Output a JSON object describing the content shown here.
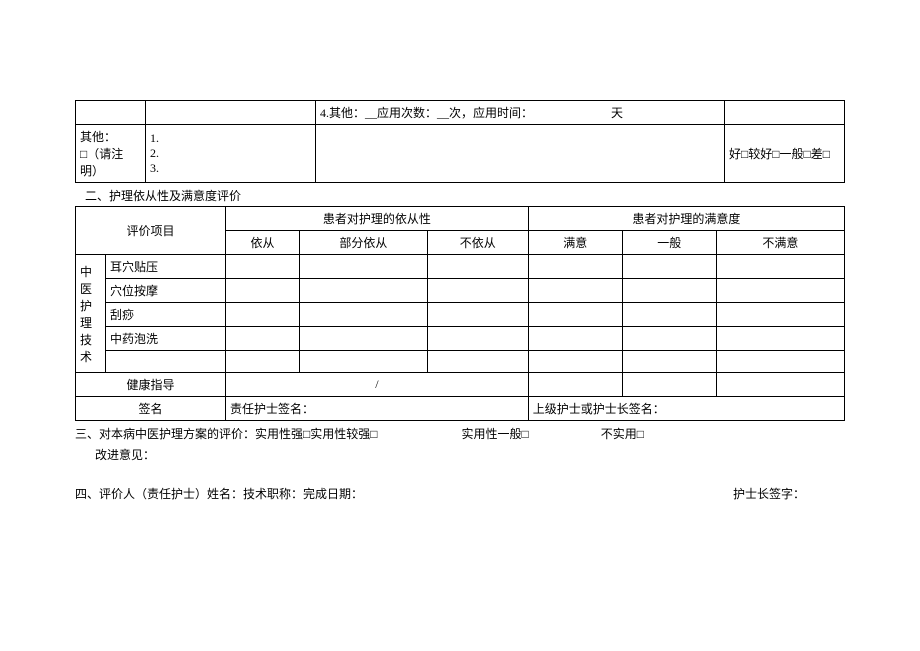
{
  "table1": {
    "row1_cell3": "4.其他：__应用次数：__次，应用时间：　　　　　　　天",
    "row2_cell1_line1": "其他：",
    "row2_cell1_line2": "□（请注明）",
    "row2_cell2_line1": "1.",
    "row2_cell2_line2": "2.",
    "row2_cell2_line3": "3.",
    "row2_cell4": "好□较好□一般□差□"
  },
  "section2": {
    "heading": "二、护理依从性及满意度评价",
    "eval_item": "评价项目",
    "compliance_header": "患者对护理的依从性",
    "satisfaction_header": "患者对护理的满意度",
    "compliance_sub": [
      "依从",
      "部分依从",
      "不依从"
    ],
    "satisfaction_sub": [
      "满意",
      "一般",
      "不满意"
    ],
    "tcm_tech": "中医护理技术",
    "tech_items": [
      "耳穴贴压",
      "穴位按摩",
      "刮痧",
      "中药泡洗"
    ],
    "health_guidance": "健康指导",
    "slash": "/",
    "signature": "签名",
    "resp_nurse_sign": "责任护士签名：",
    "senior_nurse_sign": "上级护士或护士长签名："
  },
  "section3": {
    "line1": "三、对本病中医护理方案的评价：实用性强□实用性较强□　　　　　　　实用性一般□　　　　　　不实用□",
    "line2": "改进意见："
  },
  "section4": {
    "left": "四、评价人（责任护士）姓名：技术职称：完成日期：",
    "right": "护士长签字："
  }
}
